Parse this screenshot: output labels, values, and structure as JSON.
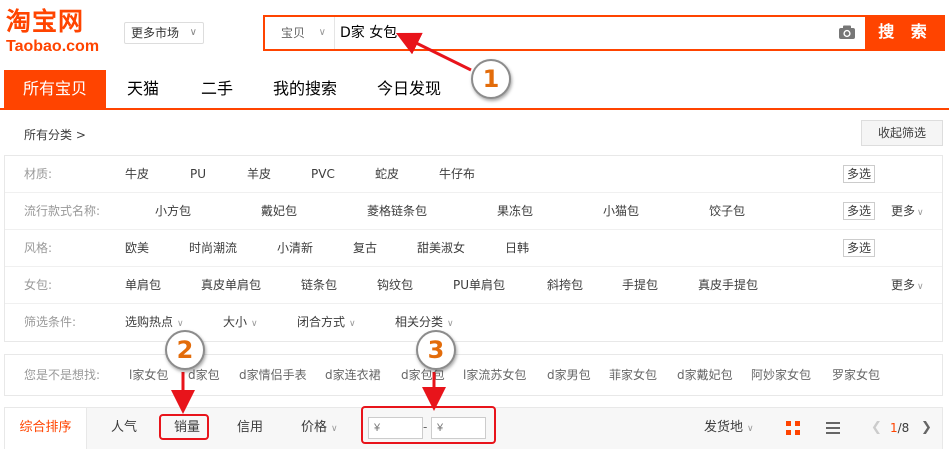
{
  "header": {
    "logo_cn": "淘宝网",
    "logo_en": "Taobao.com",
    "more_market": "更多市场",
    "search_type": "宝贝",
    "search_value": "D家 女包",
    "search_button": "搜 索"
  },
  "tabs": [
    {
      "label": "所有宝贝",
      "active": true
    },
    {
      "label": "天猫",
      "active": false
    },
    {
      "label": "二手",
      "active": false
    },
    {
      "label": "我的搜索",
      "active": false
    },
    {
      "label": "今日发现",
      "active": false
    }
  ],
  "breadcrumb": "所有分类 >",
  "collapse_filter": "收起筛选",
  "filters": {
    "material": {
      "label": "材质:",
      "options": [
        "牛皮",
        "PU",
        "羊皮",
        "PVC",
        "蛇皮",
        "牛仔布"
      ],
      "multi": "多选"
    },
    "style_name": {
      "label": "流行款式名称:",
      "options": [
        "小方包",
        "戴妃包",
        "菱格链条包",
        "果冻包",
        "小猫包",
        "饺子包"
      ],
      "multi": "多选",
      "more": "更多"
    },
    "style": {
      "label": "风格:",
      "options": [
        "欧美",
        "时尚潮流",
        "小清新",
        "复古",
        "甜美淑女",
        "日韩"
      ],
      "multi": "多选"
    },
    "bag": {
      "label": "女包:",
      "options": [
        "单肩包",
        "真皮单肩包",
        "链条包",
        "钩纹包",
        "PU单肩包",
        "斜挎包",
        "手提包",
        "真皮手提包"
      ],
      "more": "更多"
    },
    "conditions": {
      "label": "筛选条件:",
      "options": [
        "选购热点",
        "大小",
        "闭合方式",
        "相关分类"
      ]
    }
  },
  "suggestions": {
    "label": "您是不是想找:",
    "items": [
      "l家女包",
      "d家包",
      "d家情侣手表",
      "d家连衣裙",
      "d家包包",
      "l家流苏女包",
      "d家男包",
      "菲家女包",
      "d家戴妃包",
      "阿妙家女包",
      "罗家女包"
    ]
  },
  "sortbar": {
    "items": [
      "综合排序",
      "人气",
      "销量",
      "信用",
      "价格"
    ],
    "price_min_placeholder": "¥",
    "price_max_placeholder": "¥",
    "price_dash": "-",
    "ship_from": "发货地",
    "page_current": "1",
    "page_total": "/8"
  },
  "annotations": [
    "1",
    "2",
    "3"
  ],
  "colors": {
    "accent": "#ff4400",
    "annotation_red": "#e8141b",
    "annotation_number": "#e36c0a"
  },
  "icons": [
    "camera-icon",
    "chevron-down-icon",
    "grid-view-icon",
    "list-view-icon",
    "chevron-left-icon",
    "chevron-right-icon"
  ]
}
